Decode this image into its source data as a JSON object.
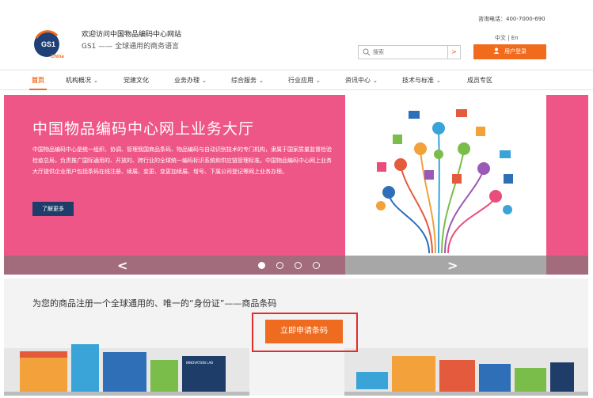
{
  "header": {
    "welcome": "欢迎访问中国物品编码中心网站",
    "tagline": "GS1 —— 全球通用的商务语言",
    "hotline": "咨询电话：400-7000-690",
    "lang": "中文 | En",
    "search_placeholder": "搜索",
    "search_button": ">",
    "login_label": "用户登录",
    "logo_text": "GS1",
    "logo_sub": "China"
  },
  "nav": {
    "items": [
      {
        "label": "首页"
      },
      {
        "label": "机构概况"
      },
      {
        "label": "党建文化"
      },
      {
        "label": "业务办理"
      },
      {
        "label": "综合服务"
      },
      {
        "label": "行业应用"
      },
      {
        "label": "资讯中心"
      },
      {
        "label": "技术与标准"
      },
      {
        "label": "成员专区"
      }
    ]
  },
  "banner": {
    "title": "中国物品编码中心网上业务大厅",
    "body": "中国物品编码中心是统一组织、协调、管理我国商品条码、物品编码与自动识别技术的专门机构，隶属于国家质量监督检验检疫总局，负责推广国际通用的、开放的、跨行业的全球统一编码标识系统和供应链管理标准。中国物品编码中心网上业务大厅提供企业用户包括条码在线注册、续展、变更、变更加续展、增号、下属公司登记等网上业务办理。",
    "learn_more": "了解更多",
    "prev": "<",
    "next": ">",
    "slide_count": 4,
    "active_slide": 1
  },
  "lower": {
    "slogan": "为您的商品注册一个全球通用的、唯一的“身份证”——商品条码",
    "apply_button": "立即申请条码",
    "sign_text": "INNOVATION LAB"
  },
  "colors": {
    "accent": "#f26b1d",
    "banner_bg": "#ef5688",
    "navy": "#1e3d69",
    "highlight_box": "#e02d2d"
  }
}
